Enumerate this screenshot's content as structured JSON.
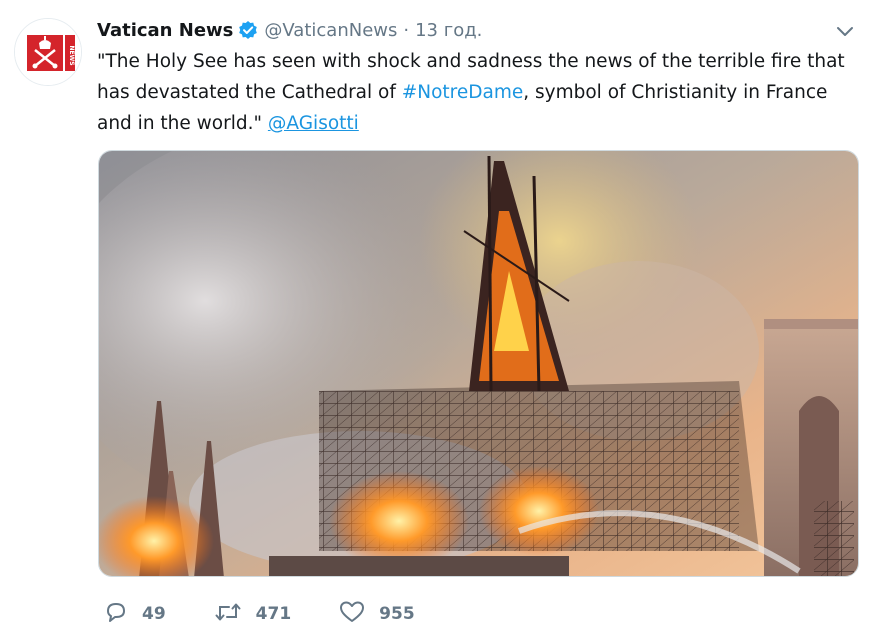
{
  "tweet": {
    "author_name": "Vatican News",
    "handle": "@VaticanNews",
    "separator": "·",
    "time": "13 год.",
    "text_part1": "\"The Holy See has seen with shock and sadness the news of the terrible fire that has devastated the Cathedral of ",
    "hashtag": "#NotreDame",
    "text_part2": ", symbol of Christianity in France and in the world.\" ",
    "mention": "@AGisotti",
    "avatar_badge_text": "NEWS"
  },
  "actions": {
    "replies": "49",
    "retweets": "471",
    "likes": "955"
  },
  "icons": {
    "verified": "verified-badge-icon",
    "caret": "chevron-down-icon",
    "reply": "reply-icon",
    "retweet": "retweet-icon",
    "like": "heart-icon"
  },
  "colors": {
    "link": "#1b95e0",
    "verified": "#1da1f2",
    "avatar_red": "#d4242b",
    "muted": "#657786"
  }
}
